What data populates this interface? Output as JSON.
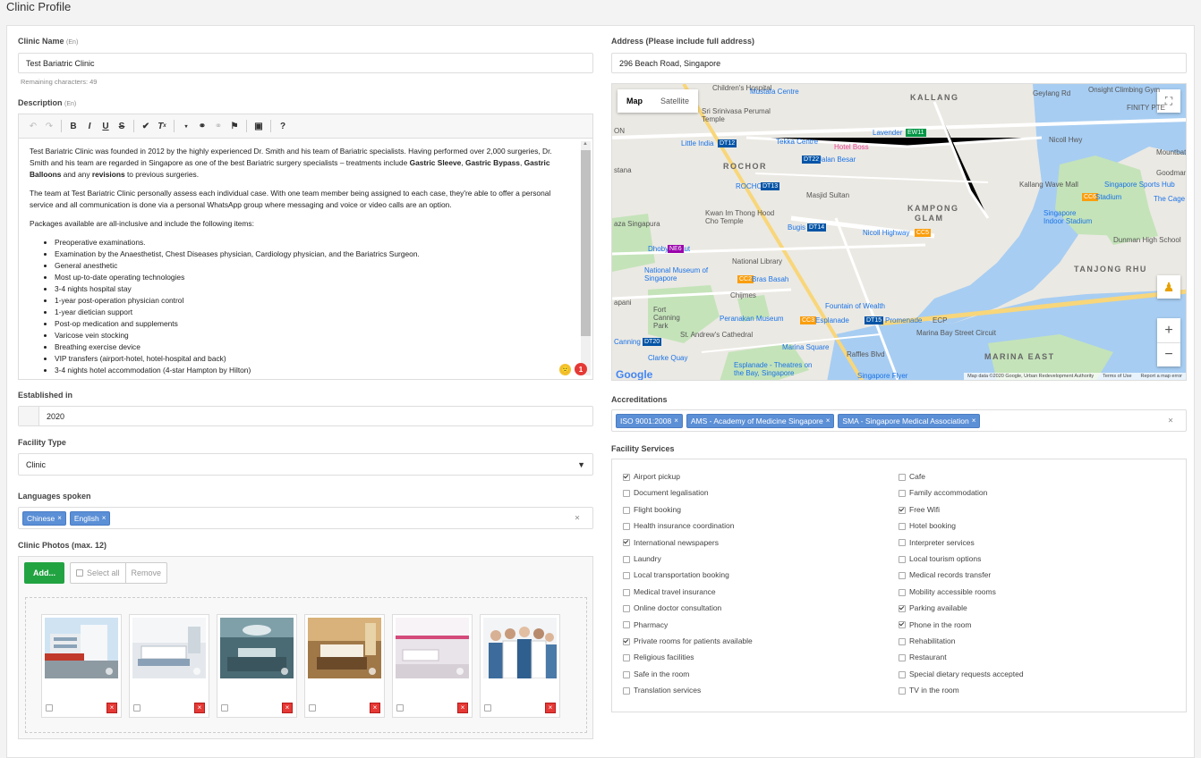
{
  "page": {
    "title": "Clinic Profile"
  },
  "clinic_name": {
    "label": "Clinic Name",
    "lang": "(En)",
    "value": "Test Bariatric Clinic",
    "remaining": "Remaining characters: 49"
  },
  "description": {
    "label": "Description",
    "lang": "(En)",
    "p1": "Test Bariatric Clinic was founded in 2012 by the highly experienced Dr. Smith and his team of Bariatric specialists. Having performed over 2,000 surgeries, Dr. Smith and his team are regarded in Singapore as one of the best Bariatric surgery specialists – treatments include",
    "p1_b1": "Gastric Sleeve",
    "p1_c1": ",",
    "p1_b2": "Gastric Bypass",
    "p1_c2": ",",
    "p1_b3": "Gastric Balloons",
    "p1_c3": "and any",
    "p1_b4": "revisions",
    "p1_c4": "to previous surgeries.",
    "p2": "The team at Test Bariatric Clinic personally assess each individual case. With one team member being assigned to each case, they're able to offer a personal service and all communication is done via a personal WhatsApp group where messaging and voice or video calls are an option.",
    "p3": "Packages available are all-inclusive and include the following items:",
    "items": [
      "Preoperative examinations.",
      "Examination by the Anaesthetist, Chest Diseases physician, Cardiology physician, and the Bariatrics Surgeon.",
      "General anesthetic",
      "Most up-to-date operating technologies",
      "3-4 nights hospital stay",
      "1-year post-operation physician control",
      "1-year dietician support",
      "Post-op medication and supplements",
      "Varicose vein stocking",
      "Breathing exercise device",
      "VIP transfers (airport-hotel, hotel-hospital and back)",
      "3-4 nights hotel accommodation (4-star Hampton by Hilton)"
    ],
    "notif_count": "1"
  },
  "established": {
    "label": "Established in",
    "value": "2020"
  },
  "facility_type": {
    "label": "Facility Type",
    "value": "Clinic"
  },
  "languages": {
    "label": "Languages spoken",
    "tags": [
      "Chinese",
      "English"
    ]
  },
  "photos": {
    "label": "Clinic Photos (max. 12)",
    "add": "Add...",
    "select_all": "Select all",
    "remove": "Remove"
  },
  "address": {
    "label": "Address (Please include full address)",
    "value": "296 Beach Road, Singapore"
  },
  "map": {
    "tab_map": "Map",
    "tab_satellite": "Satellite",
    "labels": {
      "kallang": "KALLANG",
      "rochor": "ROCHOR",
      "kampong": "KAMPONG",
      "glam": "GLAM",
      "tanjong": "TANJONG RHU",
      "marina": "MARINA EAST",
      "mustafa": "Mustafa Centre",
      "geylang": "Geylang Rd",
      "onsight": "Onsight Climbing Gym",
      "finity": "FINITY PTE",
      "sri": "Sri Srinivasa Perumal Temple",
      "tekka": "Tekka Centre",
      "hotel": "Hotel Boss",
      "lavender": "Lavender",
      "little": "Little India",
      "jalan": "Jalan Besar",
      "nicoll": "Nicoll Hwy",
      "mountbatten": "Mountbatten",
      "goodman": "Goodman Arts",
      "sports": "Singapore Sports Hub",
      "stadium": "Stadium",
      "cage": "The Cage",
      "wave": "Kallang Wave Mall",
      "indoor": "Singapore Indoor Stadium",
      "dunman": "Dunman High School",
      "masjid": "Masjid Sultan",
      "kwan": "Kwan Im Thong Hood Cho Temple",
      "bugis": "Bugis",
      "nicollhw": "Nicoll Highway",
      "dhoby": "Dhoby Ghaut",
      "natlib": "National Library",
      "natmus": "National Museum of Singapore",
      "bras": "Bras Basah",
      "chijmes": "Chijmes",
      "fort": "Fort Canning Park",
      "peranakan": "Peranakan Museum",
      "fountain": "Fountain of Wealth",
      "esplanade": "Esplanade",
      "promenade": "Promenade",
      "ecp": "ECP",
      "marinabay": "Marina Bay Street Circuit",
      "standrew": "St. Andrew's Cathedral",
      "clarke": "Clarke Quay",
      "marinasq": "Marina Square",
      "raffles": "Raffles Blvd",
      "theatres": "Esplanade - Theatres on the Bay, Singapore",
      "flyer": "Singapore Flyer",
      "canning": "Canning",
      "children": "Children's Hospital",
      "aza": "aza Singapura",
      "stana": "stana",
      "on": "ON",
      "apani": "apani",
      "google": "Google",
      "footer1": "Map data ©2020 Google, Urban Redevelopment Authority",
      "footer2": "Terms of Use",
      "footer3": "Report a map error"
    }
  },
  "accreditations": {
    "label": "Accreditations",
    "tags": [
      "ISO 9001:2008",
      "AMS - Academy of Medicine Singapore",
      "SMA - Singapore Medical Association"
    ]
  },
  "services": {
    "label": "Facility Services",
    "left": [
      {
        "name": "Airport pickup",
        "checked": true
      },
      {
        "name": "Document legalisation",
        "checked": false
      },
      {
        "name": "Flight booking",
        "checked": false
      },
      {
        "name": "Health insurance coordination",
        "checked": false
      },
      {
        "name": "International newspapers",
        "checked": true
      },
      {
        "name": "Laundry",
        "checked": false
      },
      {
        "name": "Local transportation booking",
        "checked": false
      },
      {
        "name": "Medical travel insurance",
        "checked": false
      },
      {
        "name": "Online doctor consultation",
        "checked": false
      },
      {
        "name": "Pharmacy",
        "checked": false
      },
      {
        "name": "Private rooms for patients available",
        "checked": true
      },
      {
        "name": "Religious facilities",
        "checked": false
      },
      {
        "name": "Safe in the room",
        "checked": false
      },
      {
        "name": "Translation services",
        "checked": false
      }
    ],
    "right": [
      {
        "name": "Cafe",
        "checked": false
      },
      {
        "name": "Family accommodation",
        "checked": false
      },
      {
        "name": "Free Wifi",
        "checked": true
      },
      {
        "name": "Hotel booking",
        "checked": false
      },
      {
        "name": "Interpreter services",
        "checked": false
      },
      {
        "name": "Local tourism options",
        "checked": false
      },
      {
        "name": "Medical records transfer",
        "checked": false
      },
      {
        "name": "Mobility accessible rooms",
        "checked": false
      },
      {
        "name": "Parking available",
        "checked": true
      },
      {
        "name": "Phone in the room",
        "checked": true
      },
      {
        "name": "Rehabilitation",
        "checked": false
      },
      {
        "name": "Restaurant",
        "checked": false
      },
      {
        "name": "Special dietary requests accepted",
        "checked": false
      },
      {
        "name": "TV in the room",
        "checked": false
      }
    ]
  },
  "colors": {
    "accent": "#5b8fd6",
    "add_button": "#22a342",
    "delete": "#e53935"
  }
}
